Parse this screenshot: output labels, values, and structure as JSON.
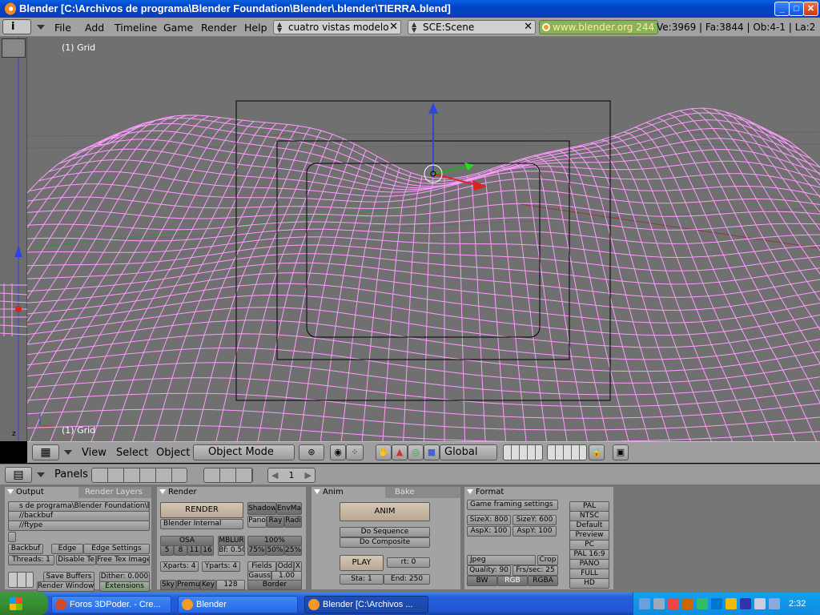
{
  "window": {
    "title": "Blender [C:\\Archivos de programa\\Blender Foundation\\Blender\\.blender\\TIERRA.blend]",
    "controls": {
      "minimize": "_",
      "maximize": "□",
      "close": "✕"
    }
  },
  "info_header": {
    "menus": [
      "File",
      "Add",
      "Timeline",
      "Game",
      "Render",
      "Help"
    ],
    "screen_field": "cuatro vistas modelo",
    "scene_field": "SCE:Scene",
    "website": "www.blender.org 244",
    "stats": "Ve:3969 | Fa:3844 | Ob:4-1 | La:2"
  },
  "viewport": {
    "top_label": "(1) Grid",
    "bottom_label": "(1) Grid",
    "mesh_color": "#ff9cff",
    "background": "#707070"
  },
  "view3d_header": {
    "menus": [
      "View",
      "Select",
      "Object"
    ],
    "mode": "Object Mode",
    "orientation": "Global"
  },
  "buttons_header": {
    "panels_label": "Panels",
    "frame": "1"
  },
  "output_panel": {
    "tab_output": "Output",
    "tab_render_layers": "Render Layers",
    "path1": "s de programa\\Blender Foundation\\Blender",
    "path2": "//backbuf",
    "path3": "//ftype",
    "backbuf": "Backbuf",
    "edge": "Edge",
    "edge_settings": "Edge Settings",
    "threads": "Threads: 1",
    "disable_tex": "Disable Te",
    "free_tex": "Free Tex Image",
    "save_buffers": "Save Buffers",
    "dither": "Dither: 0.000",
    "render_window": "Render Window",
    "extensions": "Extensions"
  },
  "render_panel": {
    "tab": "Render",
    "render_btn": "RENDER",
    "engine": "Blender Internal",
    "shadow": "Shadow",
    "envmap": "EnvMa",
    "pano": "Pano",
    "ray": "Ray",
    "radi": "Radi",
    "osa": "OSA",
    "osa_values": [
      "5",
      "8",
      "11",
      "16"
    ],
    "mblur": "MBLUR",
    "bf": "Bf: 0.50",
    "percent": "100%",
    "percents": [
      "75%",
      "50%",
      "25%"
    ],
    "xparts": "Xparts: 4",
    "yparts": "Yparts: 4",
    "fields": "Fields",
    "odd": "Odd",
    "x": "X",
    "gauss": "Gauss",
    "gauss_val": "1.00",
    "sky": "Sky",
    "premul": "Premul",
    "key": "Key",
    "size128": "128",
    "border": "Border"
  },
  "anim_panel": {
    "tab_anim": "Anim",
    "tab_bake": "Bake",
    "anim_btn": "ANIM",
    "do_sequence": "Do Sequence",
    "do_composite": "Do Composite",
    "play": "PLAY",
    "rt": "rt: 0",
    "sta": "Sta: 1",
    "end": "End: 250"
  },
  "format_panel": {
    "tab": "Format",
    "preset": "Game framing settings",
    "sizex": "SizeX: 800",
    "sizey": "SizeY: 600",
    "aspx": "AspX: 100",
    "aspy": "AspY: 100",
    "format": "Jpeg",
    "crop": "Crop",
    "quality": "Quality: 90",
    "frs": "Frs/sec: 25",
    "bw": "BW",
    "rgb": "RGB",
    "rgba": "RGBA",
    "presets": [
      "PAL",
      "NTSC",
      "Default",
      "Preview",
      "PC",
      "PAL 16:9",
      "PANO",
      "FULL",
      "HD"
    ]
  },
  "taskbar": {
    "tasks": [
      "Foros 3DPoder. - Cre...",
      "Blender",
      "Blender [C:\\Archivos ..."
    ],
    "clock": "2:32"
  }
}
